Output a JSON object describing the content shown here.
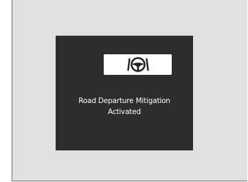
{
  "notification": {
    "icon": "road-departure-mitigation-icon",
    "message_line1": "Road Departure Mitigation",
    "message_line2": "Activated"
  },
  "colors": {
    "display_background": "#2d2d2d",
    "icon_panel": "#ffffff",
    "text": "#ffffff",
    "page_background": "#e1e1e1"
  }
}
